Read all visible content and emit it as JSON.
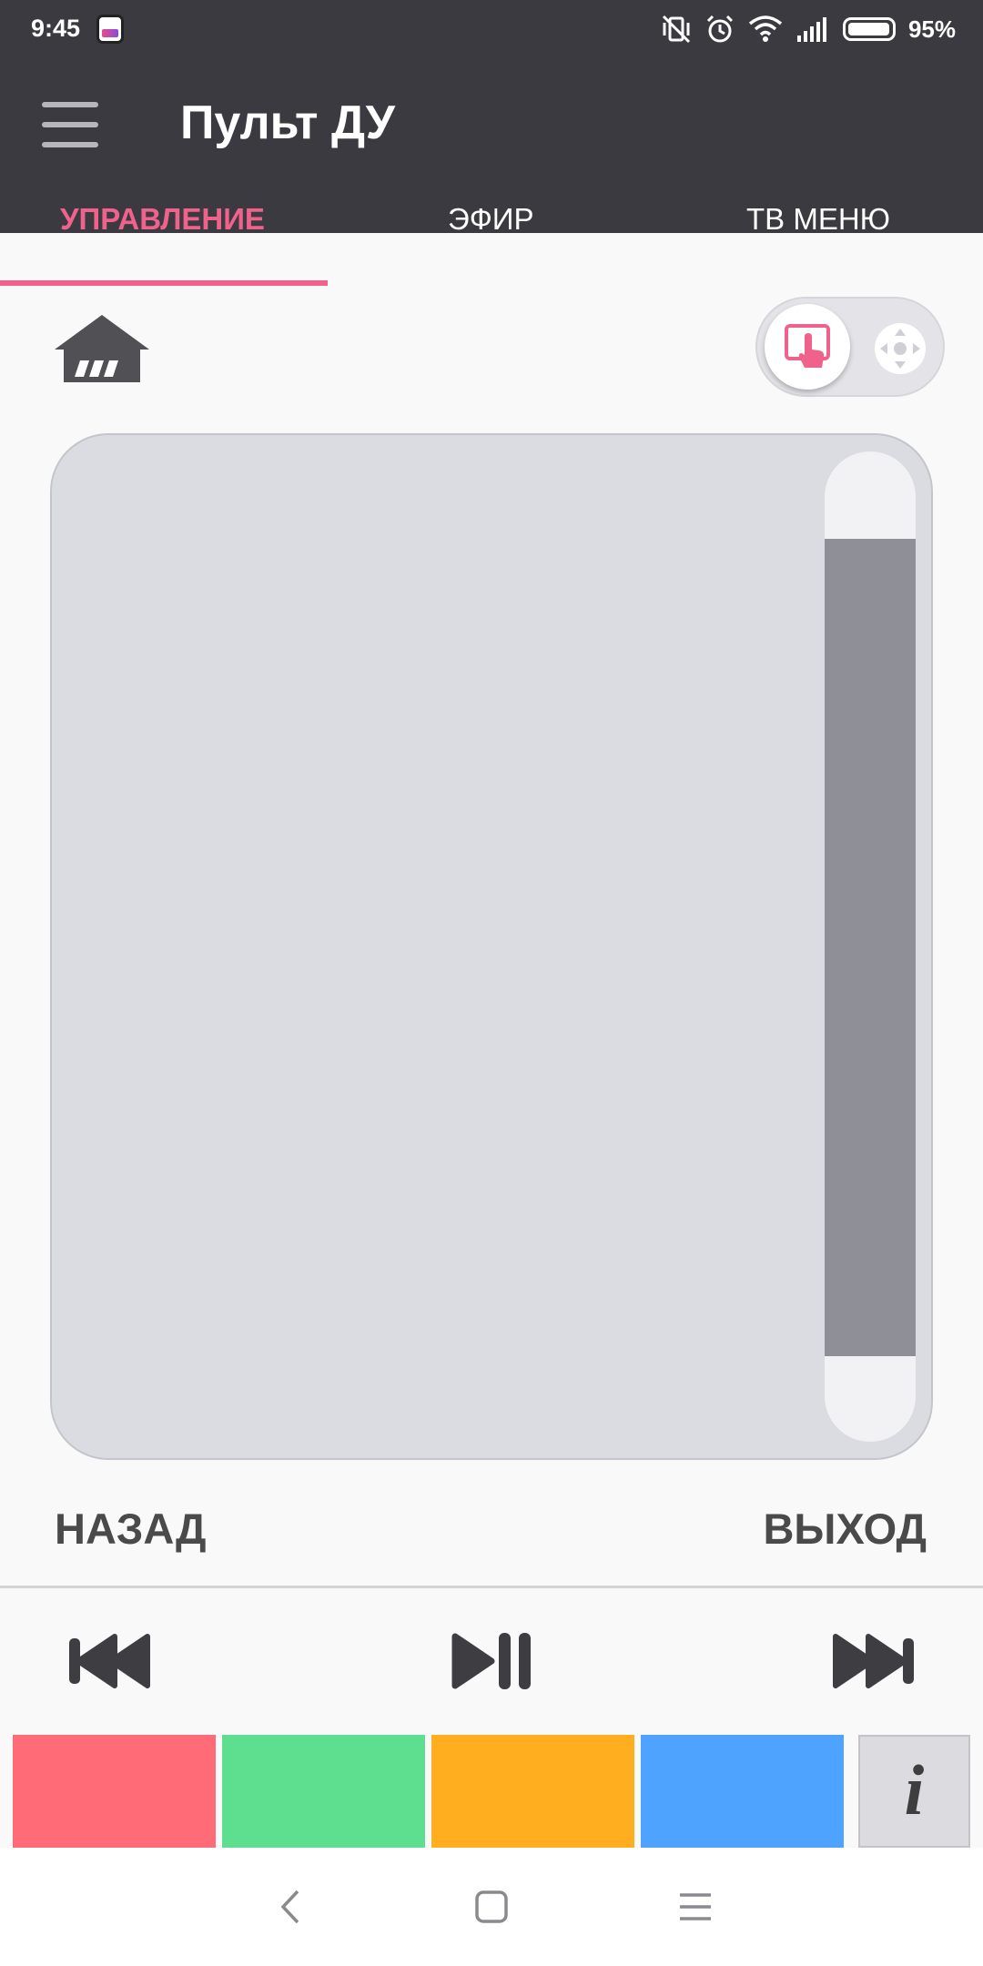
{
  "status_bar": {
    "time": "9:45",
    "battery_percent": "95%",
    "icons": [
      "app-notification-icon",
      "vibrate-off-icon",
      "alarm-icon",
      "wifi-icon",
      "signal-icon",
      "battery-icon"
    ]
  },
  "app_bar": {
    "title": "Пульт ДУ",
    "menu_icon": "hamburger-menu-icon"
  },
  "tabs": [
    {
      "label": "УПРАВЛЕНИЕ",
      "active": true
    },
    {
      "label": "ЭФИР",
      "active": false
    },
    {
      "label": "ТВ МЕНЮ",
      "active": false
    }
  ],
  "controls": {
    "home_icon": "home-icon",
    "mode_toggle": {
      "selected": "touchpad",
      "options": [
        "touchpad-icon",
        "dpad-icon"
      ]
    },
    "back_label": "НАЗАД",
    "exit_label": "ВЫХОД"
  },
  "media": {
    "prev_icon": "skip-previous-icon",
    "play_pause_icon": "play-pause-icon",
    "next_icon": "skip-next-icon"
  },
  "color_buttons": [
    {
      "name": "red",
      "color": "#ff6b76"
    },
    {
      "name": "green",
      "color": "#5ede8f"
    },
    {
      "name": "yellow",
      "color": "#ffae1f"
    },
    {
      "name": "blue",
      "color": "#4da3ff"
    }
  ],
  "info_button": {
    "label": "i"
  },
  "colors": {
    "accent": "#f0628c",
    "header_bg": "#3a3a40"
  },
  "nav_bar": [
    "back-icon",
    "home-square-icon",
    "recents-icon"
  ]
}
